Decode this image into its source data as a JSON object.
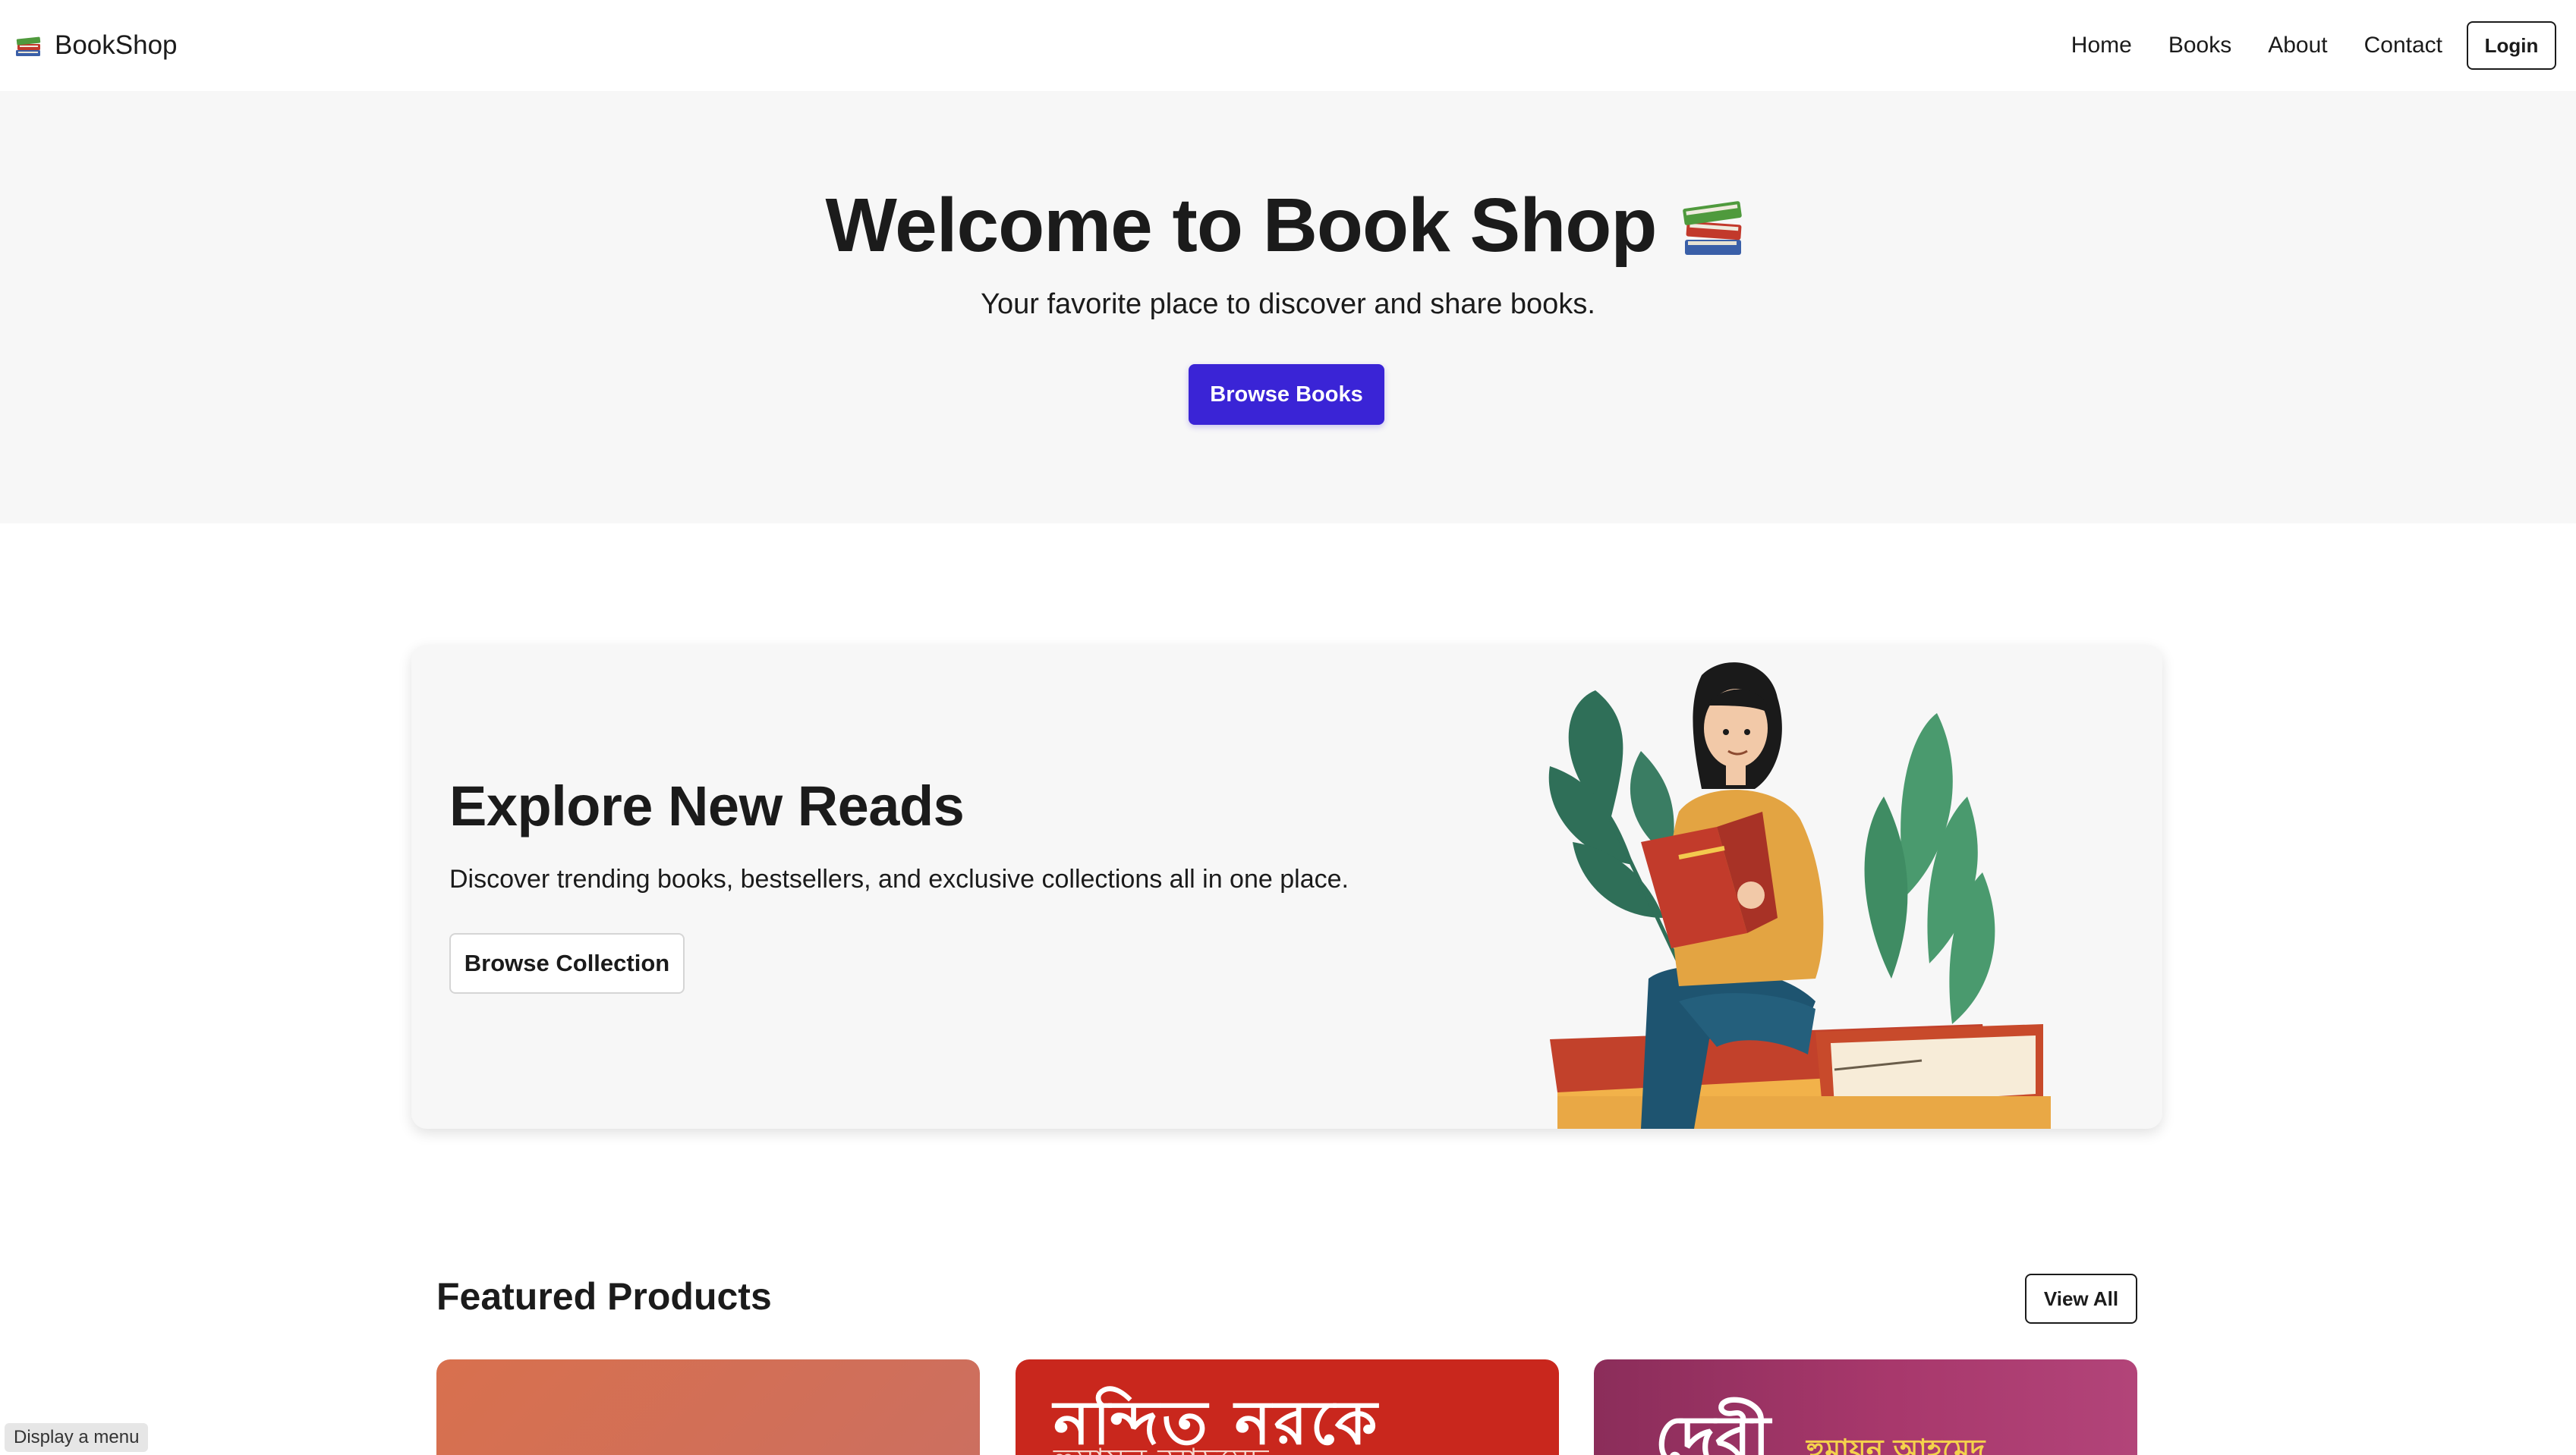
{
  "navbar": {
    "brand_icon": "books-icon",
    "brand_name": "BookShop",
    "links": [
      "Home",
      "Books",
      "About",
      "Contact"
    ],
    "login_label": "Login"
  },
  "hero": {
    "title": "Welcome to Book Shop",
    "title_icon": "books-icon",
    "subtitle": "Your favorite place to discover and share books.",
    "cta_label": "Browse Books",
    "background": "#f7f7f7",
    "accent": "#3a24d6"
  },
  "promo": {
    "title": "Explore New Reads",
    "text": "Discover trending books, bestsellers, and exclusive collections all in one place.",
    "cta_label": "Browse Collection",
    "illustration": "woman-reading-on-books-illustration"
  },
  "featured": {
    "title": "Featured Products",
    "view_all_label": "View All",
    "products": [
      {
        "cover_color": "#d16f58",
        "cover_title": "",
        "cover_author": ""
      },
      {
        "cover_color": "#c9271d",
        "cover_title": "নন্দিত নরকে",
        "cover_author": "হুমায়ূন আহমেদ"
      },
      {
        "cover_color": "#a8386c",
        "cover_title": "দেবী",
        "cover_author": "হুমায়ূন আহমেদ"
      }
    ]
  },
  "status_tooltip": "Display a menu"
}
